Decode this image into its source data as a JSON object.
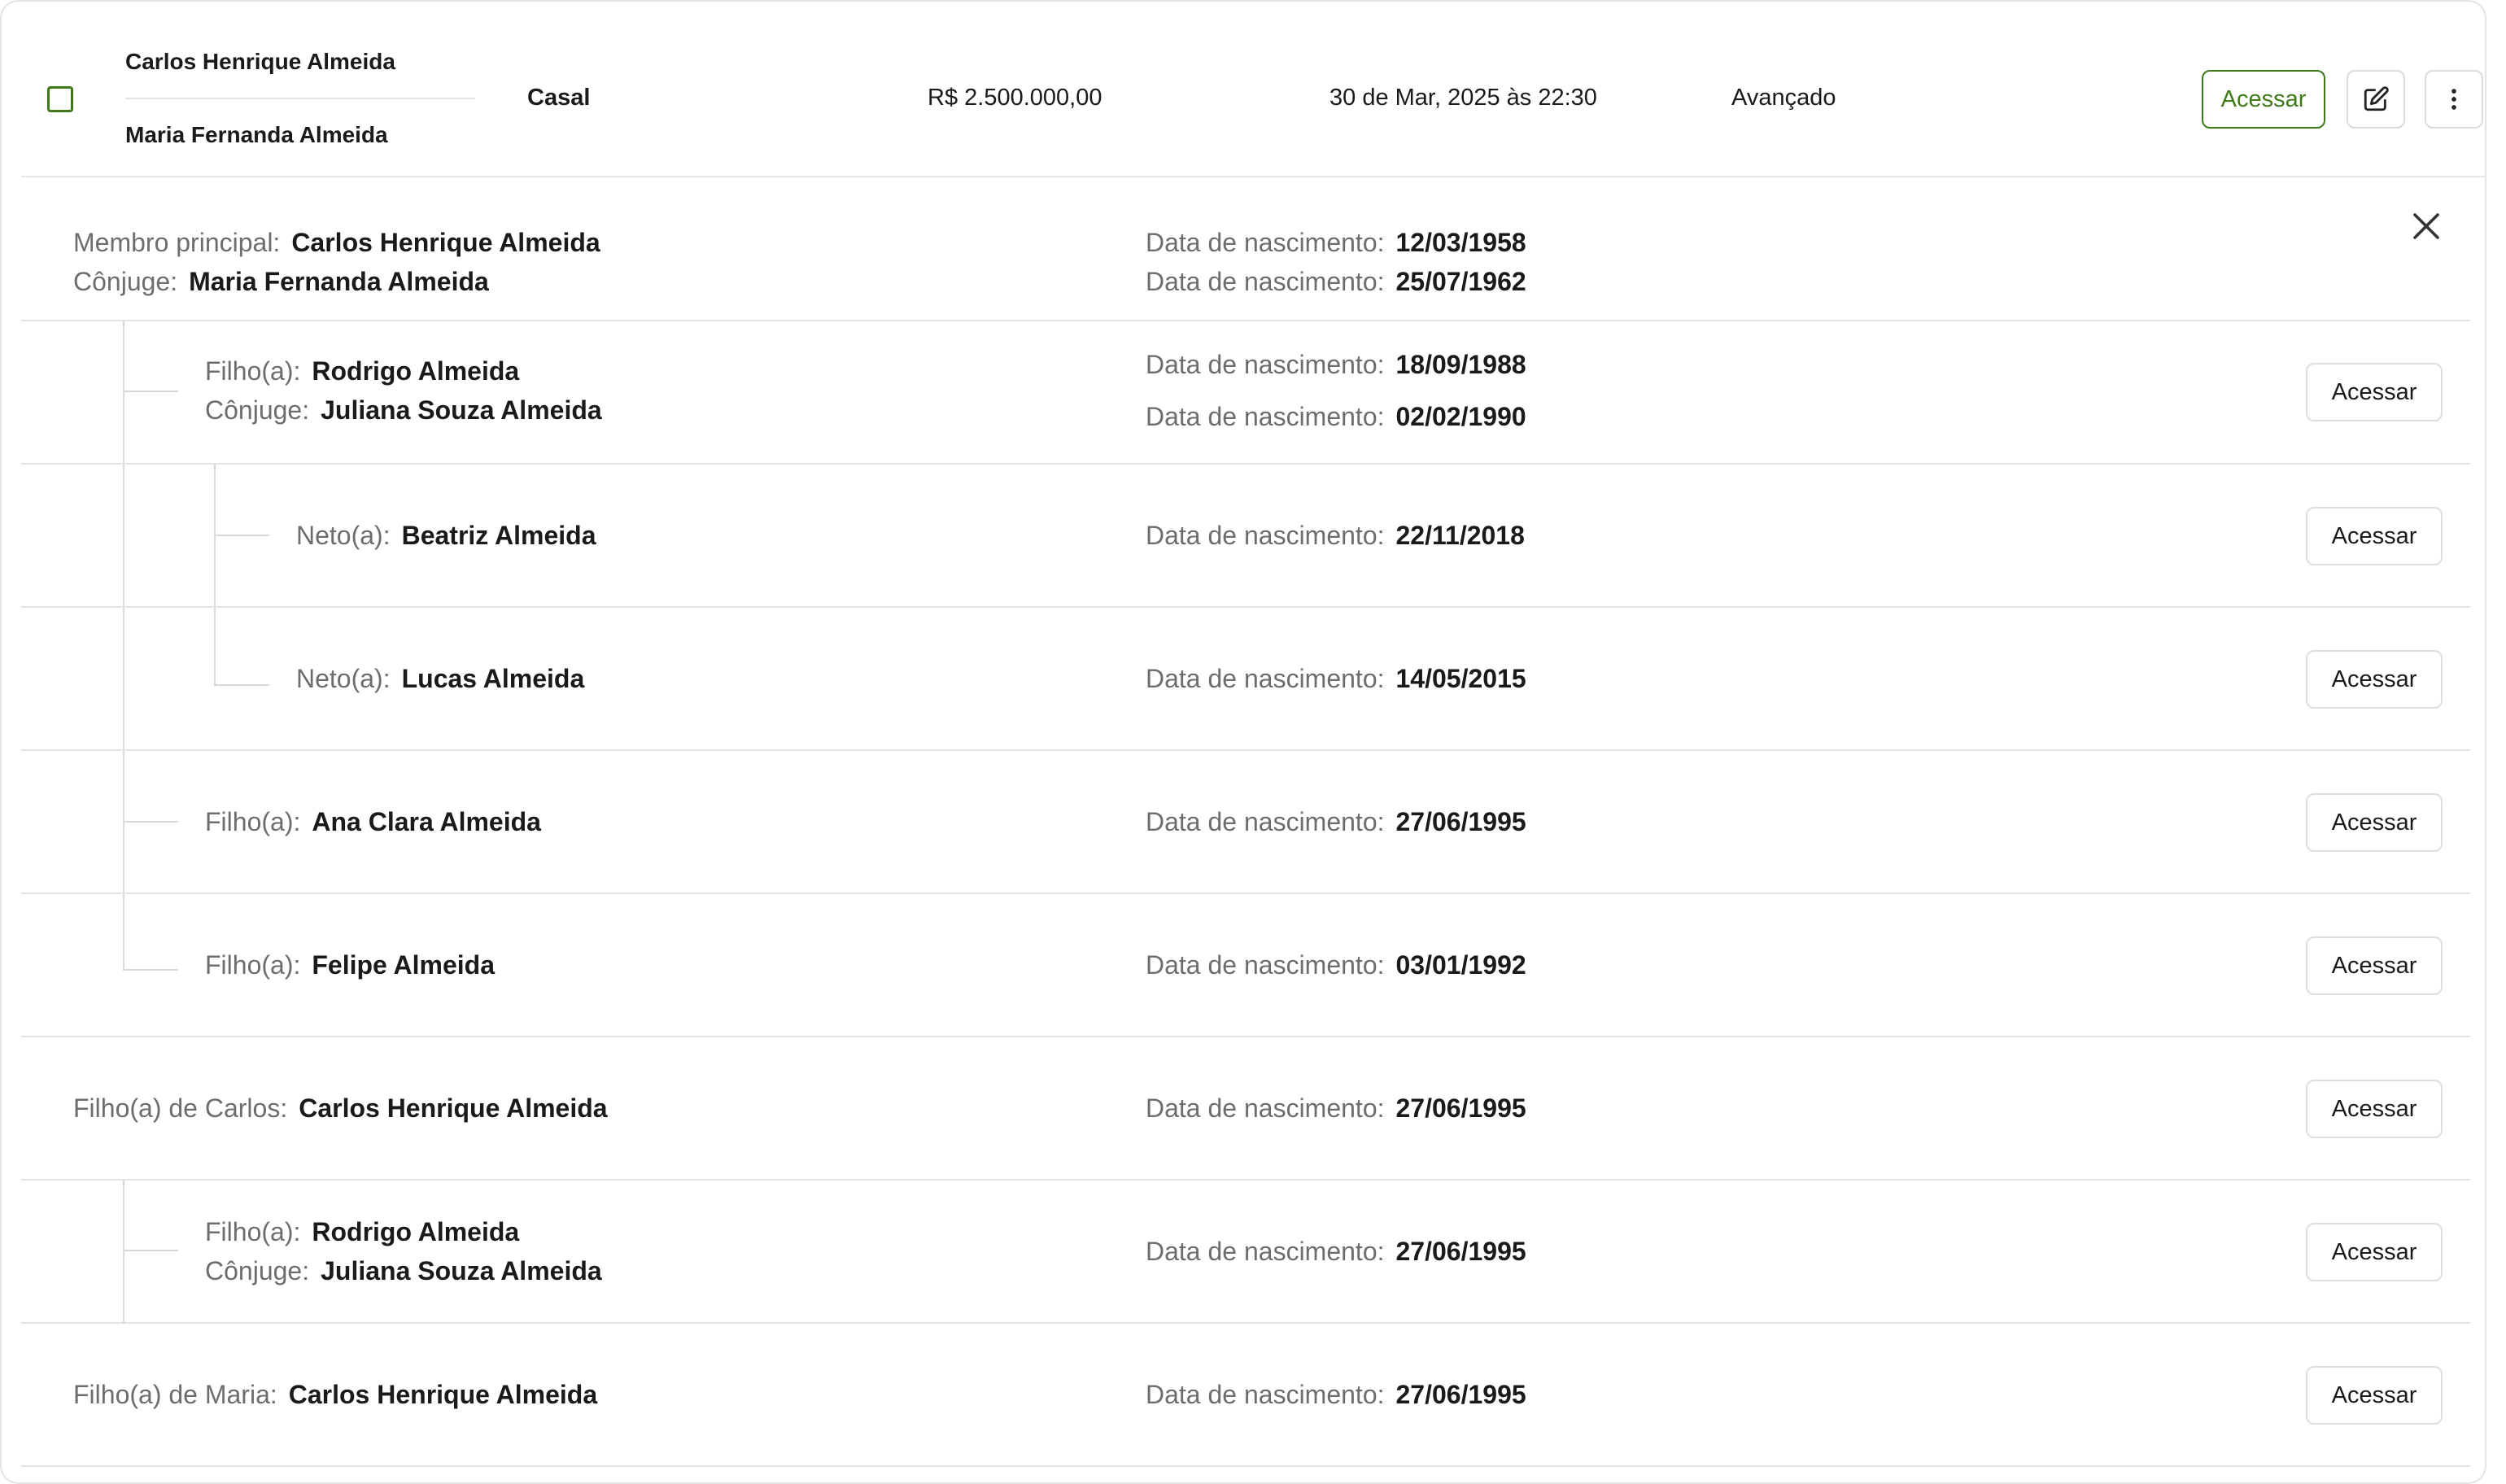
{
  "summary": {
    "member_name": "Carlos Henrique Almeida",
    "spouse_name": "Maria Fernanda Almeida",
    "type": "Casal",
    "value": "R$ 2.500.000,00",
    "datetime": "30 de Mar, 2025 às 22:30",
    "level": "Avançado",
    "access_label": "Acessar",
    "edit_icon": "edit-icon",
    "more_icon": "more-vertical-icon"
  },
  "details": {
    "close_icon": "close-icon",
    "birth_label": "Data de nascimento:",
    "access_label": "Acessar",
    "principal": {
      "label": "Membro principal:",
      "name": "Carlos Henrique Almeida",
      "birth": "12/03/1958"
    },
    "spouse": {
      "label": "Cônjuge:",
      "name": "Maria Fernanda Almeida",
      "birth": "25/07/1962"
    },
    "children": [
      {
        "label": "Filho(a):",
        "name": "Rodrigo Almeida",
        "birth": "18/09/1988",
        "spouse_label": "Cônjuge:",
        "spouse_name": "Juliana Souza Almeida",
        "spouse_birth": "02/02/1990"
      },
      {
        "label": "Neto(a):",
        "name": "Beatriz Almeida",
        "birth": "22/11/2018"
      },
      {
        "label": "Neto(a):",
        "name": "Lucas Almeida",
        "birth": "14/05/2015"
      },
      {
        "label": "Filho(a):",
        "name": "Ana Clara Almeida",
        "birth": "27/06/1995"
      },
      {
        "label": "Filho(a):",
        "name": "Felipe Almeida",
        "birth": "03/01/1992"
      }
    ],
    "carlos_child": {
      "label": "Filho(a) de Carlos:",
      "name": "Carlos Henrique Almeida",
      "birth": "27/06/1995"
    },
    "carlos_grandchild": {
      "label": "Filho(a):",
      "name": "Rodrigo Almeida",
      "spouse_label": "Cônjuge:",
      "spouse_name": "Juliana Souza Almeida",
      "birth": "27/06/1995"
    },
    "maria_child": {
      "label": "Filho(a) de Maria:",
      "name": "Carlos Henrique Almeida",
      "birth": "27/06/1995"
    }
  }
}
